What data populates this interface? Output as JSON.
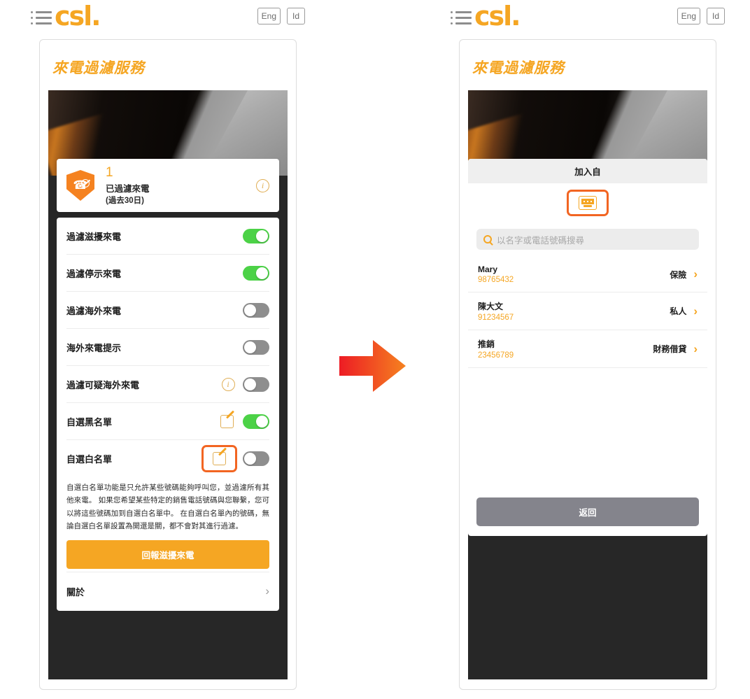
{
  "header": {
    "menu_icon": "hamburger-menu-icon",
    "logo_text": "csl.",
    "lang_primary": "Eng",
    "lang_secondary": "Id"
  },
  "card": {
    "title": "來電過濾服務"
  },
  "stat": {
    "count": "1",
    "label_line1": "已過濾來電",
    "label_line2": "(過去30日)",
    "info_icon": "i",
    "shield_icon": "blocked-call-shield-icon"
  },
  "settings": {
    "rows": [
      {
        "label": "過濾滋擾來電",
        "toggle": "on",
        "has_info": false,
        "has_edit": false
      },
      {
        "label": "過濾停示來電",
        "toggle": "on",
        "has_info": false,
        "has_edit": false
      },
      {
        "label": "過濾海外來電",
        "toggle": "off",
        "has_info": false,
        "has_edit": false
      },
      {
        "label": "海外來電提示",
        "toggle": "off",
        "has_info": false,
        "has_edit": false
      },
      {
        "label": "過濾可疑海外來電",
        "toggle": "off",
        "has_info": true,
        "has_edit": false
      },
      {
        "label": "自選黑名單",
        "toggle": "on",
        "has_info": false,
        "has_edit": true
      },
      {
        "label": "自選白名單",
        "toggle": "off",
        "has_info": false,
        "has_edit": true,
        "highlighted": true
      }
    ],
    "description": "自選白名單功能是只允許某些號碼能夠呼叫您，並過濾所有其他來電。 如果您希望某些特定的銷售電話號碼與您聯繫，您可以將這些號碼加到自選白名單中。 在自選白名單內的號碼，無論自選白名單設置為開還是關，都不會對其進行過濾。",
    "report_button": "回報滋擾來電",
    "about_label": "關於",
    "about_chevron": "›"
  },
  "modal": {
    "title": "加入自",
    "keyboard_icon": "keyboard-icon",
    "search_placeholder": "以名字或電話號碼搜尋",
    "contacts": [
      {
        "name": "Mary",
        "number": "98765432",
        "tag": "保險",
        "chevron": "›"
      },
      {
        "name": "陳大文",
        "number": "91234567",
        "tag": "私人",
        "chevron": "›"
      },
      {
        "name": "推銷",
        "number": "23456789",
        "tag": "財務借貸",
        "chevron": "›"
      }
    ],
    "back_button": "返回"
  },
  "colors": {
    "brand_orange": "#F5A623",
    "highlight_orange": "#F26522",
    "toggle_on_green": "#4CD247",
    "toggle_off_gray": "#8E8E8E",
    "back_button_gray": "#84848C",
    "phone_background": "#272727"
  },
  "arrow": {
    "name": "right-arrow",
    "gradient_from": "#ED1C24",
    "gradient_to": "#F58220"
  }
}
